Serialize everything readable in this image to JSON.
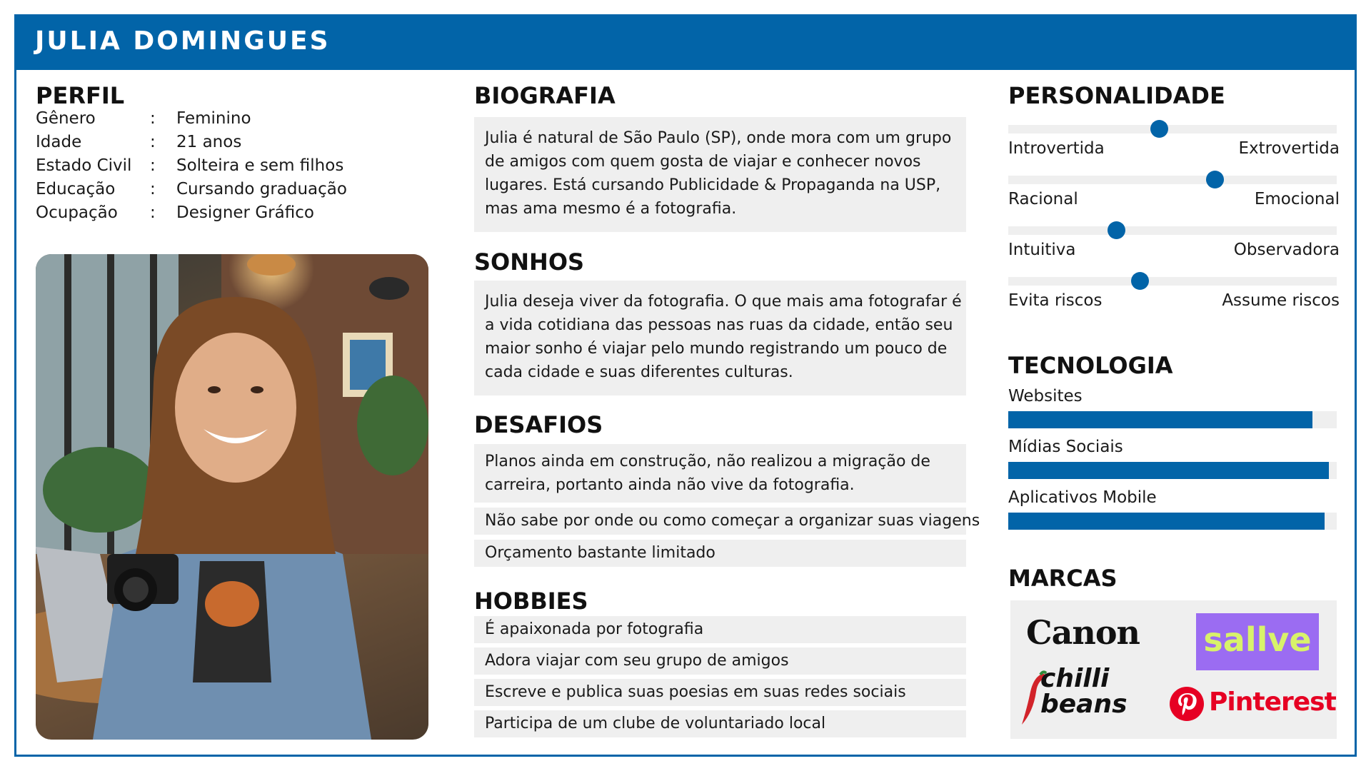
{
  "header": {
    "name": "JULIA DOMINGUES"
  },
  "profile": {
    "title": "PERFIL",
    "separator": ":",
    "rows": [
      {
        "label": "Gênero",
        "value": "Feminino"
      },
      {
        "label": "Idade",
        "value": "21 anos"
      },
      {
        "label": "Estado Civil",
        "value": "Solteira e sem filhos"
      },
      {
        "label": "Educação",
        "value": "Cursando graduação"
      },
      {
        "label": "Ocupação",
        "value": "Designer Gráfico"
      }
    ]
  },
  "biography": {
    "title": "BIOGRAFIA",
    "lines": [
      "Julia é natural de São Paulo (SP), onde mora com um grupo",
      "de amigos com quem gosta de viajar e conhecer novos",
      "lugares. Está cursando Publicidade & Propaganda na USP,",
      "mas ama mesmo é a fotografia."
    ]
  },
  "dreams": {
    "title": "SONHOS",
    "lines": [
      "Julia deseja viver da fotografia. O que mais ama fotografar é",
      "a vida cotidiana das pessoas nas ruas da cidade, então seu",
      "maior sonho é viajar pelo mundo registrando um pouco de",
      "cada cidade e suas diferentes culturas."
    ]
  },
  "challenges": {
    "title": "DESAFIOS",
    "items": [
      [
        "Planos ainda em construção, não realizou a migração de",
        "carreira, portanto ainda não vive da fotografia."
      ],
      [
        "Não sabe por onde ou como começar a organizar suas viagens"
      ],
      [
        "Orçamento bastante limitado"
      ]
    ]
  },
  "hobbies": {
    "title": "HOBBIES",
    "items": [
      "É apaixonada por fotografia",
      "Adora viajar com seu grupo de amigos",
      "Escreve e publica suas poesias em suas redes sociais",
      "Participa de um clube de voluntariado local"
    ]
  },
  "personality": {
    "title": "PERSONALIDADE",
    "scales": [
      {
        "left": "Introvertida",
        "right": "Extrovertida",
        "value": 0.46
      },
      {
        "left": "Racional",
        "right": "Emocional",
        "value": 0.63
      },
      {
        "left": "Intuitiva",
        "right": "Observadora",
        "value": 0.33
      },
      {
        "left": "Evita riscos",
        "right": "Assume riscos",
        "value": 0.4
      }
    ]
  },
  "technology": {
    "title": "TECNOLOGIA",
    "items": [
      {
        "label": "Websites",
        "value": 0.925
      },
      {
        "label": "Mídias Sociais",
        "value": 0.975
      },
      {
        "label": "Aplicativos Mobile",
        "value": 0.962
      }
    ]
  },
  "brands": {
    "title": "MARCAS",
    "logos": [
      "Canon",
      "sallve",
      "chilli beans",
      "Pinterest"
    ]
  },
  "colors": {
    "accent": "#0264a8",
    "box": "#efefef",
    "sallve": "#9b6cf2",
    "pinterest": "#e60023"
  }
}
